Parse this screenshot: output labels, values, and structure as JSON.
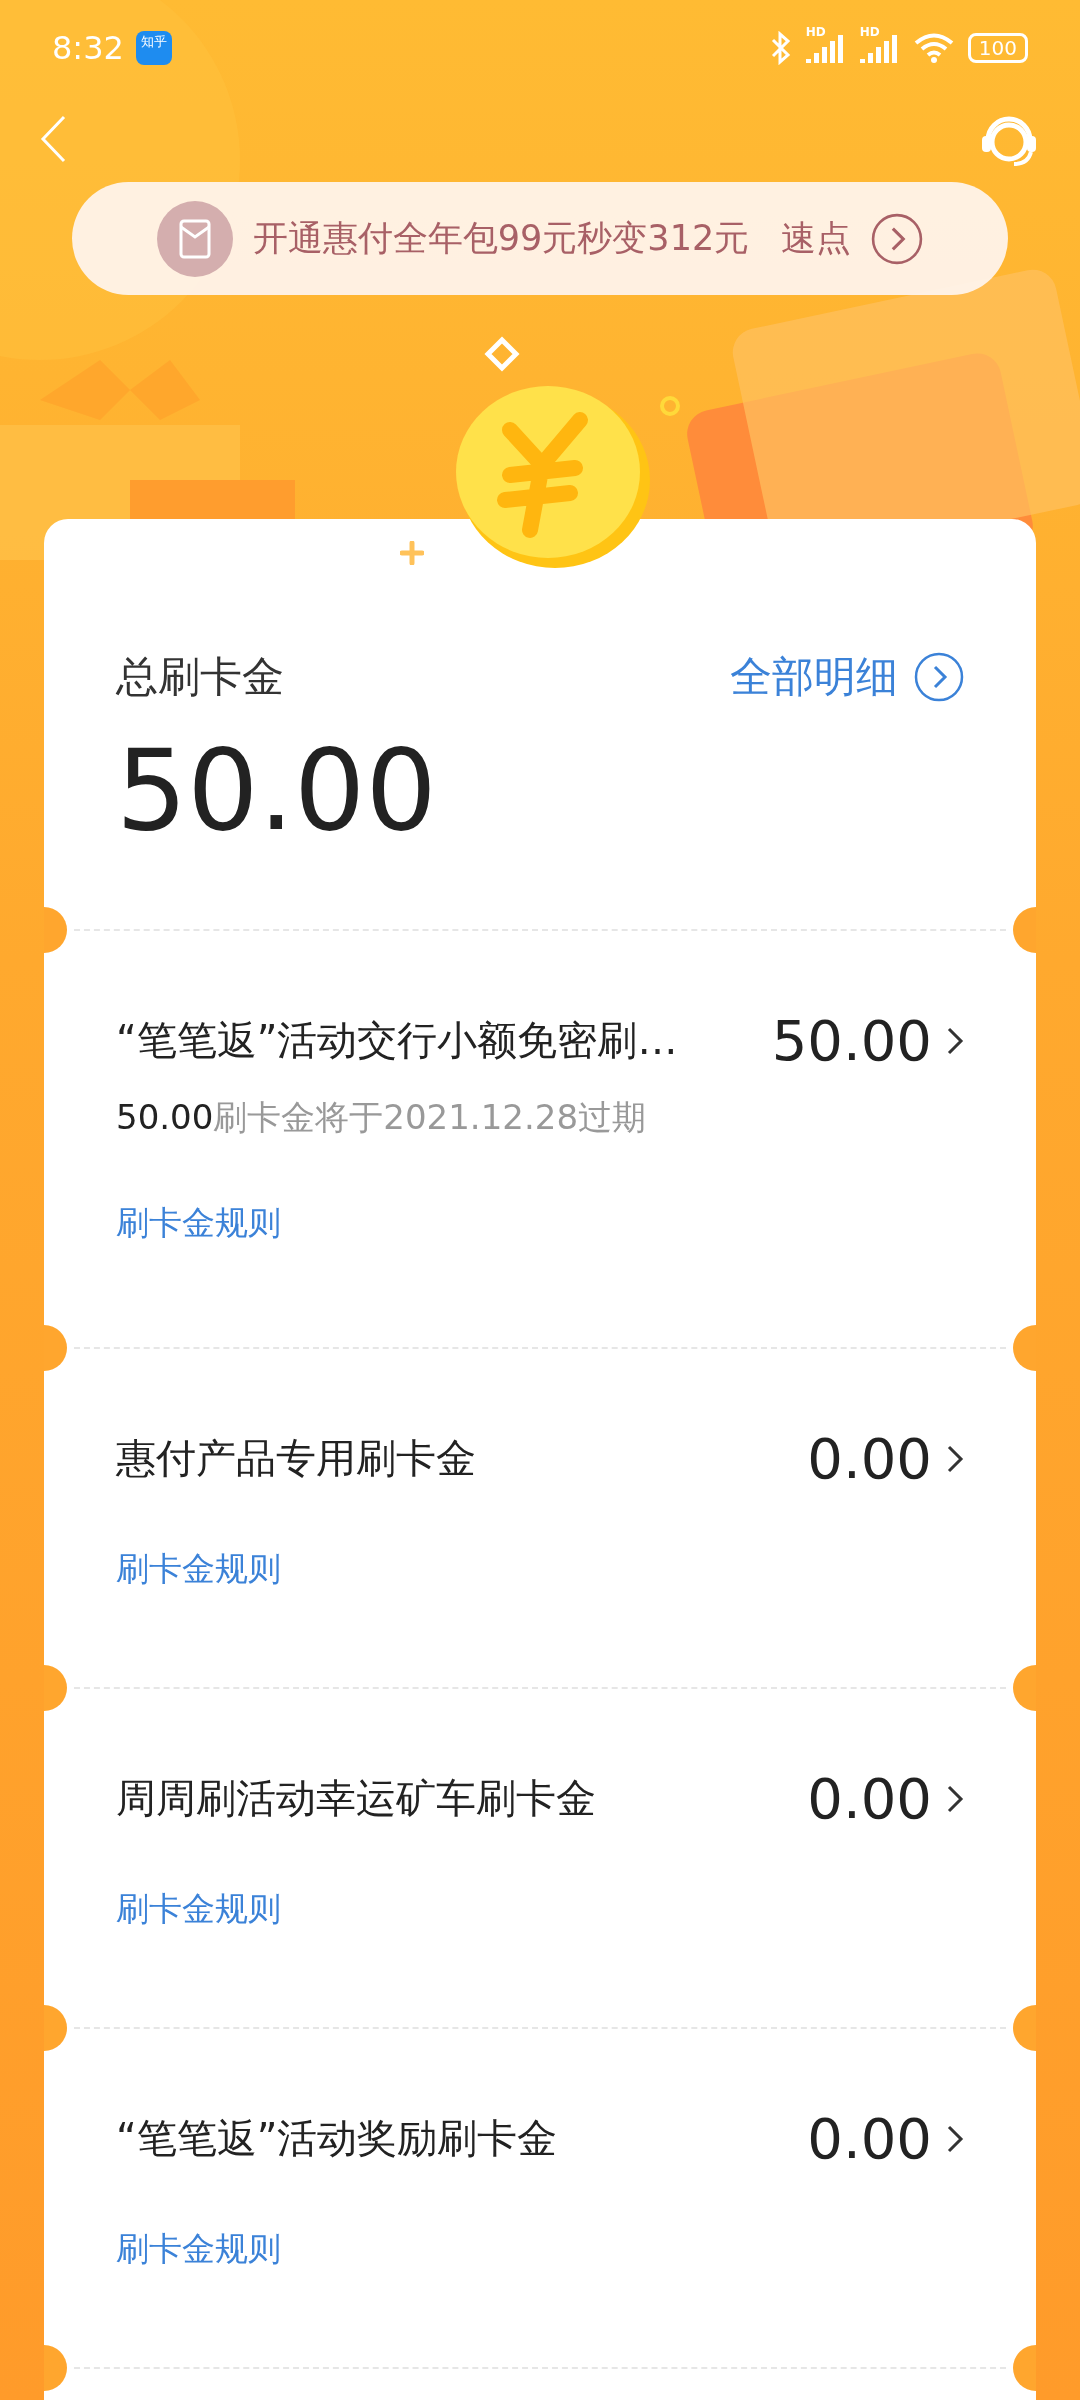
{
  "status_bar": {
    "time": "8:32",
    "app_badge": "知乎",
    "signal_labels": [
      "HD",
      "HD"
    ],
    "battery": "100"
  },
  "banner": {
    "text": "开通惠付全年包99元秒变312元",
    "action": "速点"
  },
  "summary": {
    "label": "总刷卡金",
    "link": "全部明细",
    "amount": "50.00"
  },
  "items": [
    {
      "title": "“笔笔返”活动交行小额免密刷…",
      "amount": "50.00",
      "expiry": {
        "amount": "50.00",
        "text": "刷卡金将于2021.12.28过期"
      },
      "rule": "刷卡金规则"
    },
    {
      "title": "惠付产品专用刷卡金",
      "amount": "0.00",
      "rule": "刷卡金规则"
    },
    {
      "title": "周周刷活动幸运矿车刷卡金",
      "amount": "0.00",
      "rule": "刷卡金规则"
    },
    {
      "title": "“笔笔返”活动奖励刷卡金",
      "amount": "0.00",
      "rule": "刷卡金规则"
    }
  ]
}
